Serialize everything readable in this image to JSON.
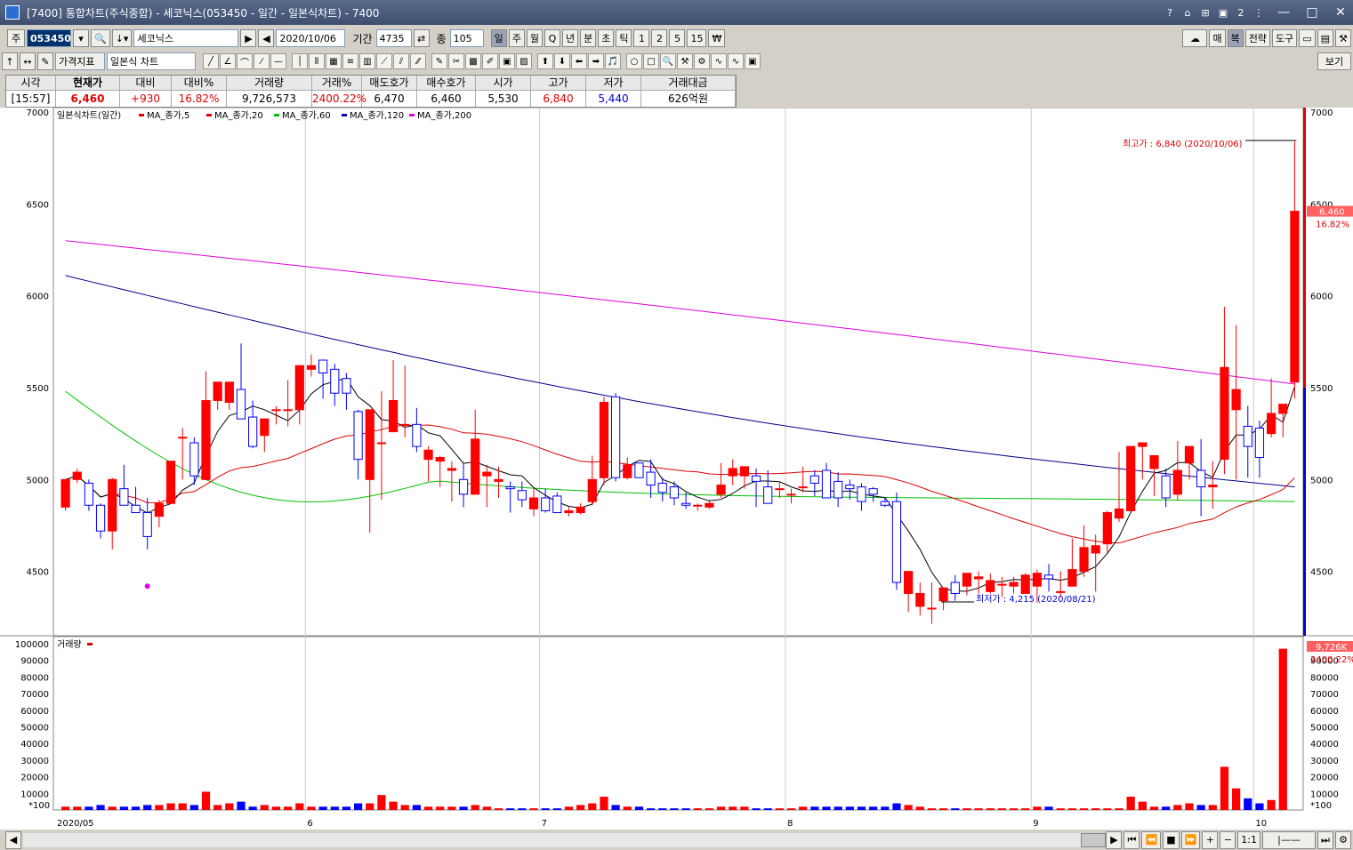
{
  "window": {
    "title": "[7400] 통합차트(주식종합) - 세코닉스(053450 - 일간 - 일본식차트) - 7400"
  },
  "toolbar": {
    "type_label": "주",
    "code": "053450",
    "name": "세코닉스",
    "date": "2020/10/06",
    "period_label": "기간",
    "period_value": "4735",
    "count_label": "종",
    "count_value": "105",
    "periods": [
      "일",
      "주",
      "월",
      "Q",
      "년",
      "분",
      "초",
      "틱",
      "1",
      "2",
      "5",
      "15",
      "₩"
    ],
    "right_buttons": [
      "매",
      "복",
      "전략",
      "도구"
    ],
    "indicator_label": "가격지표",
    "chart_type": "일본식 차트",
    "view_button": "보기"
  },
  "quote": {
    "headers": [
      "시각",
      "현재가",
      "대비",
      "대비%",
      "거래량",
      "거래%",
      "매도호가",
      "매수호가",
      "시가",
      "고가",
      "저가",
      "거래대금"
    ],
    "values": [
      "[15:57]",
      "6,460",
      "+930",
      "16.82%",
      "9,726,573",
      "2400.22%",
      "6,470",
      "6,460",
      "5,530",
      "6,840",
      "5,440",
      "626억원"
    ]
  },
  "chart": {
    "legend_title": "일본식차트(일간)",
    "ma_labels": [
      "MA_종가,5",
      "MA_종가,20",
      "MA_종가,60",
      "MA_종가,120",
      "MA_종가,200"
    ],
    "ma_colors": [
      "#000000",
      "#e00000",
      "#00c000",
      "#0000c0",
      "#e000e0"
    ],
    "price_ticks": [
      "7000",
      "6500",
      "6000",
      "5500",
      "5000",
      "4500"
    ],
    "volume_legend": "거래량",
    "volume_ticks": [
      "100000",
      "90000",
      "80000",
      "70000",
      "60000",
      "50000",
      "40000",
      "30000",
      "20000",
      "10000"
    ],
    "volume_unit": "*100",
    "x_labels": [
      "2020/05",
      "6",
      "7",
      "8",
      "9",
      "10"
    ],
    "high_note": "최고가 : 6,840 (2020/10/06)",
    "low_note": "최저가 : 4,215 (2020/08/21)",
    "cur_price_tag": "6,460",
    "cur_pct_tag": "16.82%",
    "vol_tag": "9,726K",
    "vol_pct_tag": "2400.22%",
    "colors": {
      "up": "#ff0000",
      "down": "#0000ff"
    }
  },
  "chart_data": {
    "type": "candlestick",
    "ylim": [
      4150,
      7000
    ],
    "candles": [
      [
        4850,
        5000,
        4830,
        5000
      ],
      [
        5000,
        5060,
        4980,
        5040
      ],
      [
        4980,
        5000,
        4830,
        4860
      ],
      [
        4860,
        4870,
        4680,
        4720
      ],
      [
        4720,
        5010,
        4620,
        5000
      ],
      [
        4950,
        5080,
        4880,
        4860
      ],
      [
        4860,
        4960,
        4820,
        4820
      ],
      [
        4820,
        4900,
        4620,
        4690
      ],
      [
        4800,
        4890,
        4740,
        4870
      ],
      [
        4870,
        5100,
        4870,
        5100
      ],
      [
        5230,
        5280,
        5000,
        5230
      ],
      [
        5200,
        5230,
        4970,
        5020
      ],
      [
        5000,
        5590,
        5000,
        5430
      ],
      [
        5430,
        5510,
        5380,
        5530
      ],
      [
        5420,
        5530,
        5380,
        5530
      ],
      [
        5490,
        5740,
        5340,
        5330
      ],
      [
        5340,
        5430,
        5170,
        5180
      ],
      [
        5240,
        5330,
        5150,
        5330
      ],
      [
        5380,
        5400,
        5300,
        5380
      ],
      [
        5380,
        5540,
        5290,
        5380
      ],
      [
        5380,
        5520,
        5300,
        5620
      ],
      [
        5600,
        5680,
        5560,
        5620
      ],
      [
        5650,
        5650,
        5440,
        5580
      ],
      [
        5600,
        5630,
        5400,
        5470
      ],
      [
        5550,
        5580,
        5380,
        5470
      ],
      [
        5370,
        5380,
        5000,
        5110
      ],
      [
        5000,
        5290,
        4710,
        5380
      ],
      [
        5200,
        5480,
        4890,
        5200
      ],
      [
        5260,
        5650,
        5260,
        5430
      ],
      [
        5300,
        5620,
        5230,
        5300
      ],
      [
        5300,
        5390,
        5150,
        5180
      ],
      [
        5110,
        5180,
        4990,
        5160
      ],
      [
        5100,
        5130,
        4960,
        5120
      ],
      [
        5050,
        5100,
        4880,
        5060
      ],
      [
        5000,
        5090,
        4850,
        4920
      ],
      [
        4920,
        5380,
        4920,
        5220
      ],
      [
        5020,
        5080,
        4850,
        5040
      ],
      [
        4990,
        5070,
        4900,
        5000
      ],
      [
        4960,
        4990,
        4820,
        4950
      ],
      [
        4940,
        4990,
        4850,
        4890
      ],
      [
        4840,
        4950,
        4800,
        4900
      ],
      [
        4900,
        4950,
        4820,
        4830
      ],
      [
        4910,
        4930,
        4820,
        4820
      ],
      [
        4820,
        4850,
        4800,
        4830
      ],
      [
        4820,
        4870,
        4810,
        4850
      ],
      [
        4880,
        5130,
        4860,
        5000
      ],
      [
        5010,
        5450,
        4970,
        5420
      ],
      [
        5450,
        5470,
        4990,
        5010
      ],
      [
        5010,
        5120,
        5000,
        5080
      ],
      [
        5090,
        5090,
        5010,
        5010
      ],
      [
        5040,
        5110,
        4900,
        4970
      ],
      [
        4980,
        5010,
        4880,
        4930
      ],
      [
        4960,
        4990,
        4860,
        4900
      ],
      [
        4870,
        4930,
        4840,
        4860
      ],
      [
        4860,
        4870,
        4830,
        4860
      ],
      [
        4850,
        4890,
        4840,
        4870
      ],
      [
        4920,
        5090,
        4900,
        4970
      ],
      [
        5020,
        5110,
        4970,
        5060
      ],
      [
        5020,
        5070,
        4950,
        5070
      ],
      [
        5020,
        5060,
        4850,
        4990
      ],
      [
        4960,
        5050,
        4870,
        4870
      ],
      [
        4950,
        4990,
        4900,
        4950
      ],
      [
        4920,
        4950,
        4870,
        4920
      ],
      [
        4960,
        5070,
        4930,
        4960
      ],
      [
        5020,
        5050,
        4910,
        4980
      ],
      [
        5050,
        5090,
        4900,
        4900
      ],
      [
        4990,
        5040,
        4850,
        4900
      ],
      [
        4970,
        5000,
        4890,
        4950
      ],
      [
        4960,
        4980,
        4830,
        4880
      ],
      [
        4950,
        4960,
        4880,
        4920
      ],
      [
        4880,
        4900,
        4850,
        4860
      ],
      [
        4880,
        4930,
        4400,
        4440
      ],
      [
        4380,
        4420,
        4280,
        4500
      ],
      [
        4310,
        4440,
        4260,
        4380
      ],
      [
        4300,
        4440,
        4215,
        4300
      ],
      [
        4340,
        4390,
        4290,
        4410
      ],
      [
        4440,
        4480,
        4340,
        4380
      ],
      [
        4420,
        4480,
        4370,
        4490
      ],
      [
        4460,
        4500,
        4380,
        4470
      ],
      [
        4390,
        4490,
        4380,
        4450
      ],
      [
        4430,
        4470,
        4360,
        4430
      ],
      [
        4420,
        4470,
        4380,
        4440
      ],
      [
        4380,
        4490,
        4380,
        4480
      ],
      [
        4420,
        4510,
        4330,
        4490
      ],
      [
        4480,
        4540,
        4390,
        4460
      ],
      [
        4390,
        4500,
        4360,
        4390
      ],
      [
        4420,
        4680,
        4420,
        4510
      ],
      [
        4500,
        4750,
        4470,
        4630
      ],
      [
        4600,
        4700,
        4390,
        4640
      ],
      [
        4650,
        4830,
        4600,
        4820
      ],
      [
        4790,
        5150,
        4770,
        4840
      ],
      [
        4830,
        5140,
        4830,
        5180
      ],
      [
        5180,
        5200,
        5000,
        5200
      ],
      [
        5060,
        5110,
        4910,
        5130
      ],
      [
        5020,
        5060,
        4850,
        4900
      ],
      [
        4920,
        5210,
        4890,
        5050
      ],
      [
        5090,
        5170,
        5000,
        5180
      ],
      [
        5050,
        5220,
        4800,
        4960
      ],
      [
        4960,
        5100,
        4840,
        4970
      ],
      [
        5110,
        5940,
        5030,
        5610
      ],
      [
        5380,
        5840,
        5000,
        5490
      ],
      [
        5290,
        5400,
        5010,
        5180
      ],
      [
        5280,
        5320,
        5010,
        5120
      ],
      [
        5250,
        5550,
        5230,
        5360
      ],
      [
        5360,
        5380,
        5230,
        5410
      ],
      [
        5530,
        6840,
        5440,
        6460
      ]
    ],
    "volume": [
      2,
      2,
      2,
      3,
      2,
      2,
      2,
      3,
      3,
      4,
      4,
      3,
      11,
      3,
      4,
      5,
      2,
      3,
      2,
      2,
      4,
      2,
      2,
      2,
      2,
      4,
      4,
      9,
      5,
      3,
      3,
      2,
      2,
      2,
      2,
      3,
      2,
      1,
      1,
      1,
      1,
      1,
      1,
      2,
      3,
      4,
      8,
      3,
      2,
      2,
      1,
      1,
      1,
      1,
      1,
      1,
      2,
      2,
      2,
      1,
      1,
      1,
      1,
      2,
      2,
      2,
      2,
      2,
      2,
      2,
      2,
      4,
      3,
      2,
      1,
      1,
      1,
      1,
      1,
      1,
      1,
      1,
      1,
      2,
      2,
      1,
      1,
      1,
      1,
      1,
      1,
      8,
      5,
      2,
      2,
      3,
      4,
      3,
      3,
      26,
      13,
      7,
      4,
      6,
      97
    ]
  }
}
